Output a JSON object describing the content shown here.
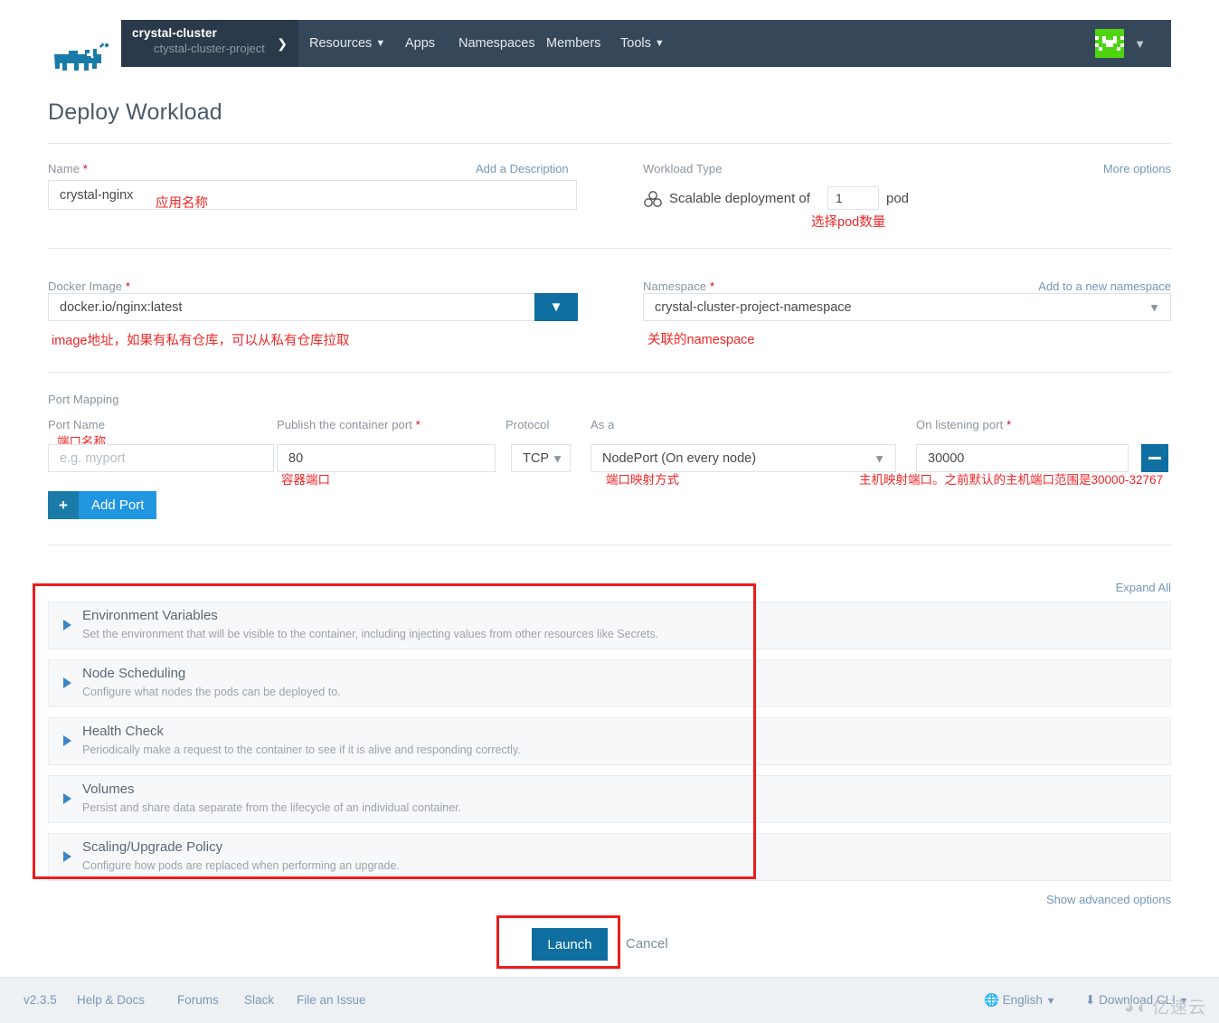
{
  "nav": {
    "cluster": "crystal-cluster",
    "project": "ctystal-cluster-project",
    "links": [
      {
        "label": "Resources",
        "caret": true
      },
      {
        "label": "Apps",
        "caret": false
      },
      {
        "label": "Namespaces",
        "caret": false
      },
      {
        "label": "Members",
        "caret": false
      },
      {
        "label": "Tools",
        "caret": true
      }
    ],
    "caret_glyph": "⌄"
  },
  "page": {
    "title": "Deploy Workload"
  },
  "name_field": {
    "label": "Name",
    "required": "*",
    "add_description": "Add a Description",
    "value": "crystal-nginx",
    "annotation": "应用名称"
  },
  "workload_type": {
    "label": "Workload Type",
    "more_options": "More options",
    "prefix": "Scalable deployment of",
    "count": "1",
    "suffix": "pod",
    "annotation": "选择pod数量"
  },
  "docker_image": {
    "label": "Docker Image",
    "required": "*",
    "value": "docker.io/nginx:latest",
    "annotation": "image地址，如果有私有仓库，可以从私有仓库拉取"
  },
  "namespace": {
    "label": "Namespace",
    "required": "*",
    "add_new": "Add to a new namespace",
    "value": "crystal-cluster-project-namespace",
    "annotation": "关联的namespace"
  },
  "port_mapping": {
    "section_label": "Port Mapping",
    "columns": {
      "port_name": "Port Name",
      "container_port": "Publish the container port",
      "container_port_required": "*",
      "protocol": "Protocol",
      "as_a": "As a",
      "listening_port": "On listening port",
      "listening_port_required": "*"
    },
    "row": {
      "port_name_placeholder": "e.g. myport",
      "port_name_value": "",
      "container_port": "80",
      "protocol": "TCP",
      "as_a": "NodePort (On every node)",
      "listening_port": "30000"
    },
    "annotations": {
      "port_name": "端口名称",
      "container_port": "容器端口",
      "as_a": "端口映射方式",
      "listening_port": "主机映射端口。之前默认的主机端口范围是30000-32767"
    },
    "add_port_label": "Add Port",
    "add_port_icon": "+",
    "remove_icon": "minus-icon"
  },
  "accordion": {
    "expand_all": "Expand All",
    "show_advanced": "Show advanced options",
    "sections": [
      {
        "title": "Environment Variables",
        "desc": "Set the environment that will be visible to the container, including injecting values from other resources like Secrets."
      },
      {
        "title": "Node Scheduling",
        "desc": "Configure what nodes the pods can be deployed to."
      },
      {
        "title": "Health Check",
        "desc": "Periodically make a request to the container to see if it is alive and responding correctly."
      },
      {
        "title": "Volumes",
        "desc": "Persist and share data separate from the lifecycle of an individual container."
      },
      {
        "title": "Scaling/Upgrade Policy",
        "desc": "Configure how pods are replaced when performing an upgrade."
      }
    ]
  },
  "actions": {
    "launch": "Launch",
    "cancel": "Cancel"
  },
  "footer": {
    "version": "v2.3.5",
    "links": [
      "Help & Docs",
      "Forums",
      "Slack",
      "File an Issue"
    ],
    "language": "English",
    "download_cli": "Download CLI",
    "watermark": "亿速云"
  },
  "colors": {
    "nav_bg": "#37475a",
    "chip_bg": "#2b3a4a",
    "primary": "#0f6fa0",
    "accent_light": "#2196e0",
    "annotation_red": "#ef2727",
    "redbox": "#ee1c1c",
    "link": "#7397b8",
    "logo_blue": "#1b7ba8",
    "avatar_green": "#4fd412"
  }
}
